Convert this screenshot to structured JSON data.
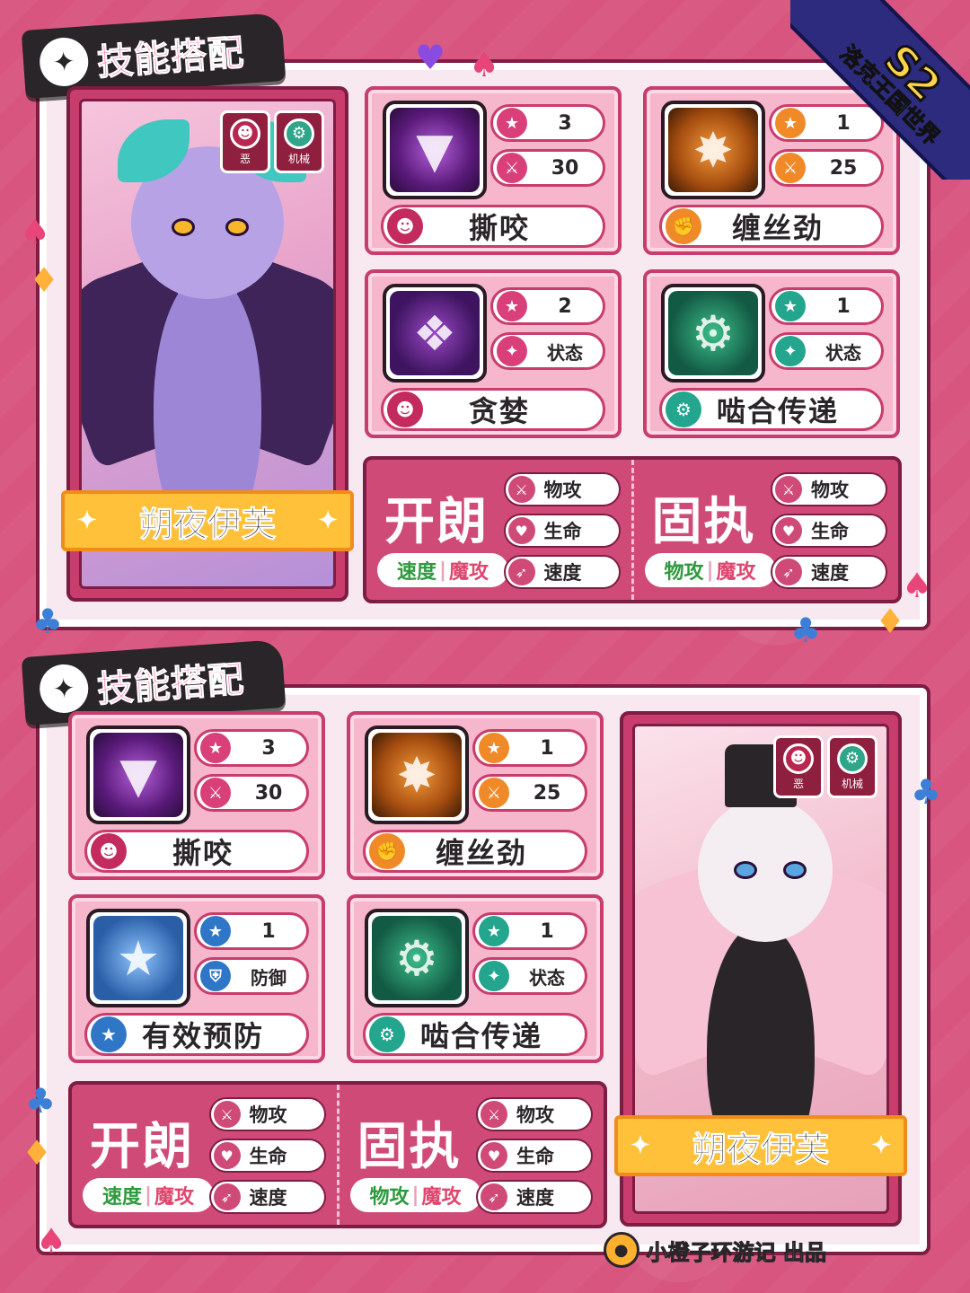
{
  "badge": {
    "season": "S2",
    "game": "洛克王国世界"
  },
  "sections": [
    {
      "title": "技能搭配",
      "character": {
        "name": "朔夜伊芙",
        "types": [
          "恶",
          "机械"
        ]
      },
      "skills": [
        {
          "name": "撕咬",
          "cost": "3",
          "stat2": "30",
          "stat2_icon": "sword-icon",
          "type_icon": "dark-type-icon",
          "art": "bite"
        },
        {
          "name": "缠丝劲",
          "cost": "1",
          "stat2": "25",
          "stat2_icon": "sword-icon",
          "type_icon": "fighting-type-icon",
          "art": "silk"
        },
        {
          "name": "贪婪",
          "cost": "2",
          "stat2": "状态",
          "stat2_icon": "sparkle-icon",
          "type_icon": "dark-type-icon",
          "art": "greed"
        },
        {
          "name": "啮合传递",
          "cost": "1",
          "stat2": "状态",
          "stat2_icon": "sparkle-icon",
          "type_icon": "mech-type-icon",
          "art": "gear"
        }
      ],
      "natures": [
        {
          "name": "开朗",
          "up": "速度",
          "down": "魔攻",
          "stats": [
            "物攻",
            "生命",
            "速度"
          ]
        },
        {
          "name": "固执",
          "up": "物攻",
          "down": "魔攻",
          "stats": [
            "物攻",
            "生命",
            "速度"
          ]
        }
      ]
    },
    {
      "title": "技能搭配",
      "character": {
        "name": "朔夜伊芙",
        "types": [
          "恶",
          "机械"
        ]
      },
      "skills": [
        {
          "name": "撕咬",
          "cost": "3",
          "stat2": "30",
          "stat2_icon": "sword-icon",
          "type_icon": "dark-type-icon",
          "art": "bite"
        },
        {
          "name": "缠丝劲",
          "cost": "1",
          "stat2": "25",
          "stat2_icon": "sword-icon",
          "type_icon": "fighting-type-icon",
          "art": "silk"
        },
        {
          "name": "有效预防",
          "cost": "1",
          "stat2": "防御",
          "stat2_icon": "shield-icon",
          "type_icon": "normal-type-icon",
          "art": "shield"
        },
        {
          "name": "啮合传递",
          "cost": "1",
          "stat2": "状态",
          "stat2_icon": "sparkle-icon",
          "type_icon": "mech-type-icon",
          "art": "gear"
        }
      ],
      "natures": [
        {
          "name": "开朗",
          "up": "速度",
          "down": "魔攻",
          "stats": [
            "物攻",
            "生命",
            "速度"
          ]
        },
        {
          "name": "固执",
          "up": "物攻",
          "down": "魔攻",
          "stats": [
            "物攻",
            "生命",
            "速度"
          ]
        }
      ]
    }
  ],
  "footer": {
    "text": "小橙子环游记 出品"
  }
}
